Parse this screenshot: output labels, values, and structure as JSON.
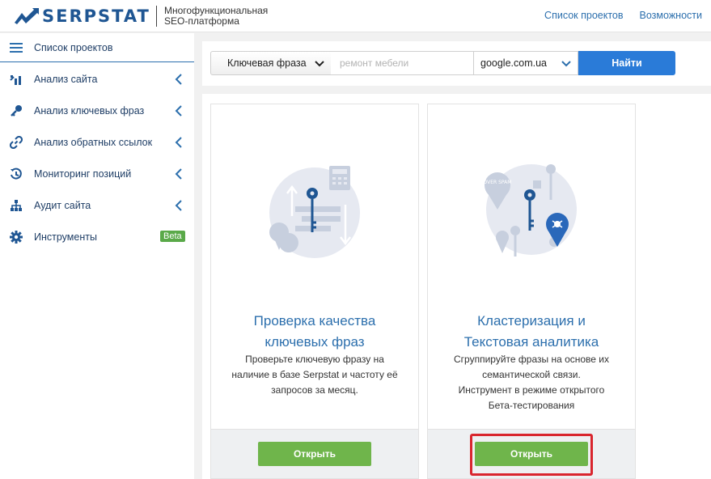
{
  "header": {
    "logo_text": "SERPSTAT",
    "tagline_line1": "Многофункциональная",
    "tagline_line2": "SEO-платформа",
    "nav": [
      "Список проектов",
      "Возможности"
    ]
  },
  "sidebar": {
    "items": [
      {
        "label": "Список проектов",
        "icon": "menu-icon"
      },
      {
        "label": "Анализ сайта",
        "icon": "chart-icon"
      },
      {
        "label": "Анализ ключевых фраз",
        "icon": "key-icon"
      },
      {
        "label": "Анализ обратных ссылок",
        "icon": "link-icon"
      },
      {
        "label": "Мониторинг позиций",
        "icon": "history-icon"
      },
      {
        "label": "Аудит сайта",
        "icon": "sitemap-icon"
      },
      {
        "label": "Инструменты",
        "icon": "gear-icon",
        "badge": "Beta"
      }
    ]
  },
  "search": {
    "type_label": "Ключевая фраза",
    "placeholder": "ремонт мебели",
    "engine": "google.com.ua",
    "button": "Найти"
  },
  "cards": [
    {
      "title_line1": "Проверка качества",
      "title_line2": "ключевых фраз",
      "desc": [
        "Проверьте ключевую фразу на",
        "наличие в базе Serpstat и частоту её",
        "запросов за месяц."
      ],
      "button": "Открыть"
    },
    {
      "title_line1": "Кластеризация и",
      "title_line2": "Текстовая аналитика",
      "desc": [
        "Сгруппируйте фразы на основе их",
        "семантической связи.",
        "Инструмент в режиме открытого",
        "Бета-тестирования"
      ],
      "button": "Открыть",
      "illustration_text": "OVER SPAM"
    }
  ],
  "colors": {
    "brand": "#1f5693",
    "link": "#2c6fad",
    "primary_button": "#2a7bd8",
    "open_button": "#6fb54b",
    "highlight": "#d9262e"
  }
}
